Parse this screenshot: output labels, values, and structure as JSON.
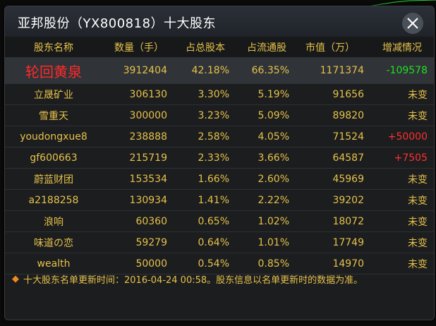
{
  "dialog": {
    "title": "亚邦股份（YX800818）十大股东",
    "close_icon": "close-icon"
  },
  "columns": [
    "股东名称",
    "数量（手）",
    "占总股本",
    "占流通股",
    "市值（万）",
    "增减情况"
  ],
  "rows": [
    {
      "name": "轮回黄泉",
      "qty": "3912404",
      "total": "42.18%",
      "float": "66.35%",
      "mv": "1171374",
      "chg": "-109578",
      "chg_kind": "down",
      "highlight": true
    },
    {
      "name": "立晟矿业",
      "qty": "306130",
      "total": "3.30%",
      "float": "5.19%",
      "mv": "91656",
      "chg": "未变",
      "chg_kind": "same"
    },
    {
      "name": "雪重天",
      "qty": "300000",
      "total": "3.23%",
      "float": "5.09%",
      "mv": "89820",
      "chg": "未变",
      "chg_kind": "same"
    },
    {
      "name": "youdongxue8",
      "qty": "238888",
      "total": "2.58%",
      "float": "4.05%",
      "mv": "71524",
      "chg": "+50000",
      "chg_kind": "up"
    },
    {
      "name": "gf600663",
      "qty": "215719",
      "total": "2.33%",
      "float": "3.66%",
      "mv": "64587",
      "chg": "+7505",
      "chg_kind": "up"
    },
    {
      "name": "蔚蓝财团",
      "qty": "153534",
      "total": "1.66%",
      "float": "2.60%",
      "mv": "45969",
      "chg": "未变",
      "chg_kind": "same"
    },
    {
      "name": "a2188258",
      "qty": "130934",
      "total": "1.41%",
      "float": "2.22%",
      "mv": "39202",
      "chg": "未变",
      "chg_kind": "same"
    },
    {
      "name": "浪响",
      "qty": "60360",
      "total": "0.65%",
      "float": "1.02%",
      "mv": "18072",
      "chg": "未变",
      "chg_kind": "same"
    },
    {
      "name": "味道の恋",
      "qty": "59279",
      "total": "0.64%",
      "float": "1.01%",
      "mv": "17749",
      "chg": "未变",
      "chg_kind": "same"
    },
    {
      "name": "wealth",
      "qty": "50000",
      "total": "0.54%",
      "float": "0.85%",
      "mv": "14970",
      "chg": "未变",
      "chg_kind": "same"
    }
  ],
  "footer": {
    "icon": "diamond-icon",
    "note": "十大股东名单更新时间：2016-04-24 00:58。股东信息以名单更新时的数据为准。"
  },
  "colors": {
    "accent": "#e6c24a",
    "down": "#22e022",
    "up": "#ff3030",
    "highlight_name": "#ff2a2a"
  }
}
